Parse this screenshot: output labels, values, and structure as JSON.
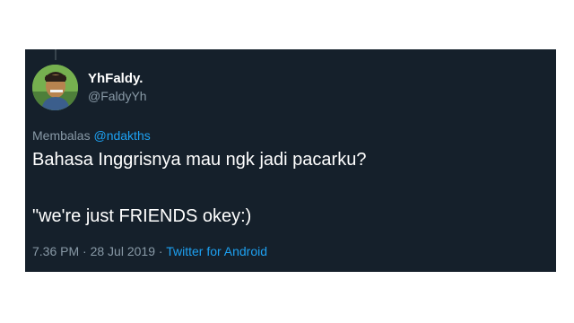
{
  "tweet": {
    "display_name": "YhFaldy.",
    "handle": "@FaldyYh",
    "reply_prefix": "Membalas",
    "reply_to": "@ndakths",
    "text_line_1": "Bahasa Inggrisnya mau ngk jadi pacarku?",
    "text_line_2": "\"we're just FRIENDS okey:)",
    "time": "7.36 PM",
    "separator": "·",
    "date": "28 Jul 2019",
    "source": "Twitter for Android"
  },
  "colors": {
    "background": "#15202b",
    "text_primary": "#ffffff",
    "text_secondary": "#8899a6",
    "accent": "#1da1f2"
  },
  "icons": {
    "avatar": "user-avatar-photo"
  }
}
